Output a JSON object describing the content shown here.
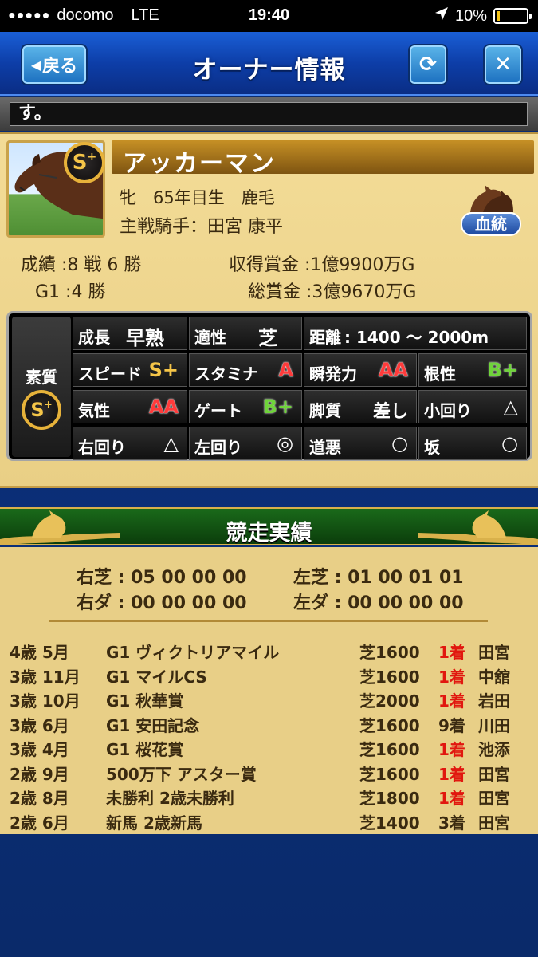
{
  "status_bar": {
    "carrier": "docomo",
    "network": "LTE",
    "time": "19:40",
    "battery": "10%",
    "battery_level": 0.1
  },
  "header": {
    "back_label": "戻る",
    "title": "オーナー情報"
  },
  "ticker": {
    "text": "す。"
  },
  "horse": {
    "rank": "S",
    "rank_plus": "+",
    "name": "アッカーマン",
    "profile": "牝　65年目生　鹿毛",
    "jockey": "主戦騎手：田宮 康平",
    "pedigree_label": "血統",
    "record": "成績 :8 戦 6 勝",
    "g1": "G1 :4 勝",
    "earned_prize": "収得賞金 :1億9900万G",
    "total_prize": "総賞金 :3億9670万G"
  },
  "attributes": {
    "title": "素質",
    "rank": "S",
    "rank_plus": "+",
    "cells": [
      {
        "key": "成長",
        "value": "早熟"
      },
      {
        "key": "適性",
        "value": "芝"
      },
      {
        "key": "距離",
        "value": ": 1400 〜 2000m"
      },
      {
        "key": "スピード",
        "value": "S+"
      },
      {
        "key": "スタミナ",
        "value": "A"
      },
      {
        "key": "瞬発力",
        "value": "AA"
      },
      {
        "key": "根性",
        "value": "B+"
      },
      {
        "key": "気性",
        "value": "AA"
      },
      {
        "key": "ゲート",
        "value": "B+"
      },
      {
        "key": "脚質",
        "value": "差し"
      },
      {
        "key": "小回り",
        "value": "△"
      },
      {
        "key": "右回り",
        "value": "△"
      },
      {
        "key": "左回り",
        "value": "◎"
      },
      {
        "key": "道悪",
        "value": "○"
      },
      {
        "key": "坂",
        "value": "○"
      }
    ]
  },
  "record_section": {
    "title": "競走実績",
    "right_turf": "右芝 : 05 00 00 00",
    "left_turf": "左芝 : 01 00 01 01",
    "right_dirt": "右ダ : 00 00 00 00",
    "left_dirt": "左ダ : 00 00 00 00",
    "races": [
      {
        "date": "4歳 5月",
        "race": "G1 ヴィクトリアマイル",
        "course": "芝1600",
        "place": "1着",
        "jockey": "田宮",
        "win": true
      },
      {
        "date": "3歳 11月",
        "race": "G1 マイルCS",
        "course": "芝1600",
        "place": "1着",
        "jockey": "中舘",
        "win": true
      },
      {
        "date": "3歳 10月",
        "race": "G1 秋華賞",
        "course": "芝2000",
        "place": "1着",
        "jockey": "岩田",
        "win": true
      },
      {
        "date": "3歳 6月",
        "race": "G1 安田記念",
        "course": "芝1600",
        "place": "9着",
        "jockey": "川田",
        "win": false
      },
      {
        "date": "3歳 4月",
        "race": "G1 桜花賞",
        "course": "芝1600",
        "place": "1着",
        "jockey": "池添",
        "win": true
      },
      {
        "date": "2歳 9月",
        "race": "500万下 アスター賞",
        "course": "芝1600",
        "place": "1着",
        "jockey": "田宮",
        "win": true
      },
      {
        "date": "2歳 8月",
        "race": "未勝利 2歳未勝利",
        "course": "芝1800",
        "place": "1着",
        "jockey": "田宮",
        "win": true
      },
      {
        "date": "2歳 6月",
        "race": "新馬 2歳新馬",
        "course": "芝1400",
        "place": "3着",
        "jockey": "田宮",
        "win": false
      }
    ]
  }
}
